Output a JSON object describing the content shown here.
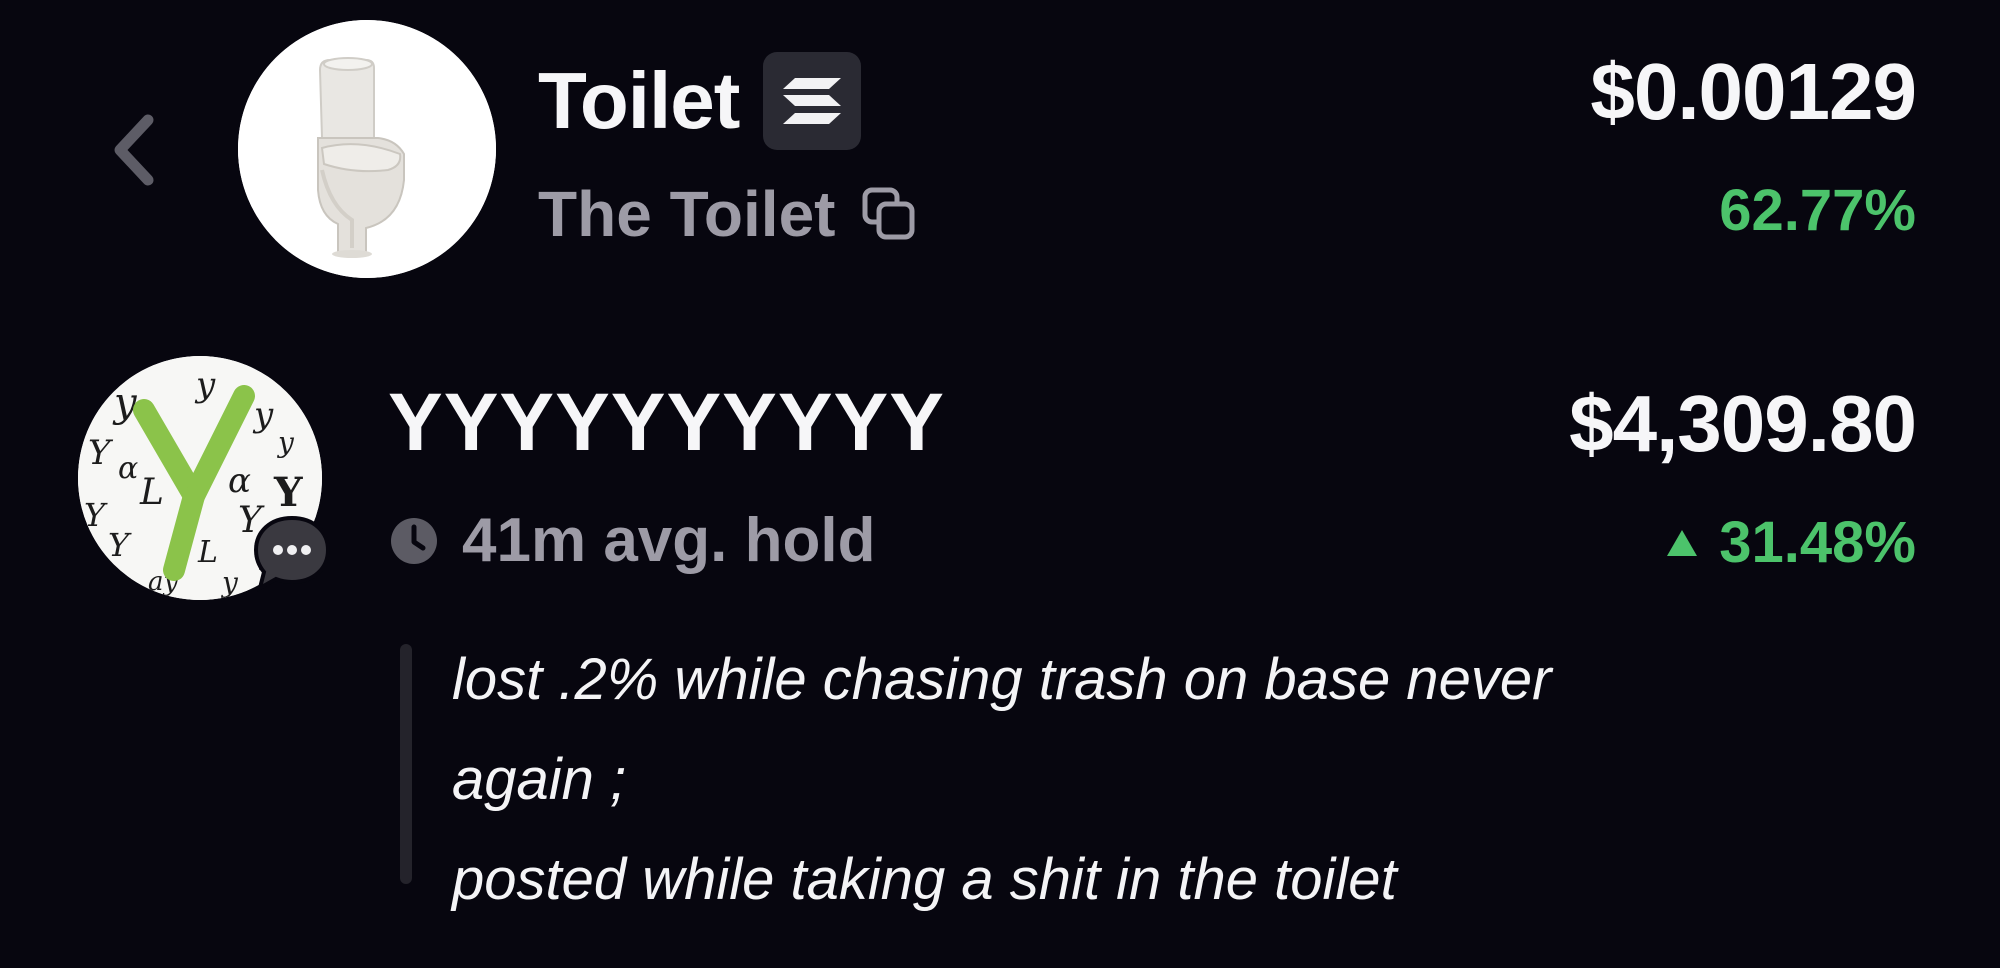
{
  "token": {
    "symbol": "Toilet",
    "name": "The Toilet",
    "price": "$0.00129",
    "change": "62.77%",
    "chain_icon": "solana-icon",
    "change_color": "#4cc36b"
  },
  "trader": {
    "name": "YYYYYYYYYY",
    "avg_hold": "41m avg. hold",
    "trade_value": "$4,309.80",
    "trade_change": "31.48%",
    "change_direction": "up"
  },
  "comment": {
    "lines": [
      "lost .2% while chasing trash on base never",
      "again ;",
      "posted while taking a shit in the toilet"
    ]
  },
  "colors": {
    "background": "#07060f",
    "primary_text": "#f6f6f8",
    "secondary_text": "#9d9ba6",
    "positive": "#4cc36b"
  }
}
